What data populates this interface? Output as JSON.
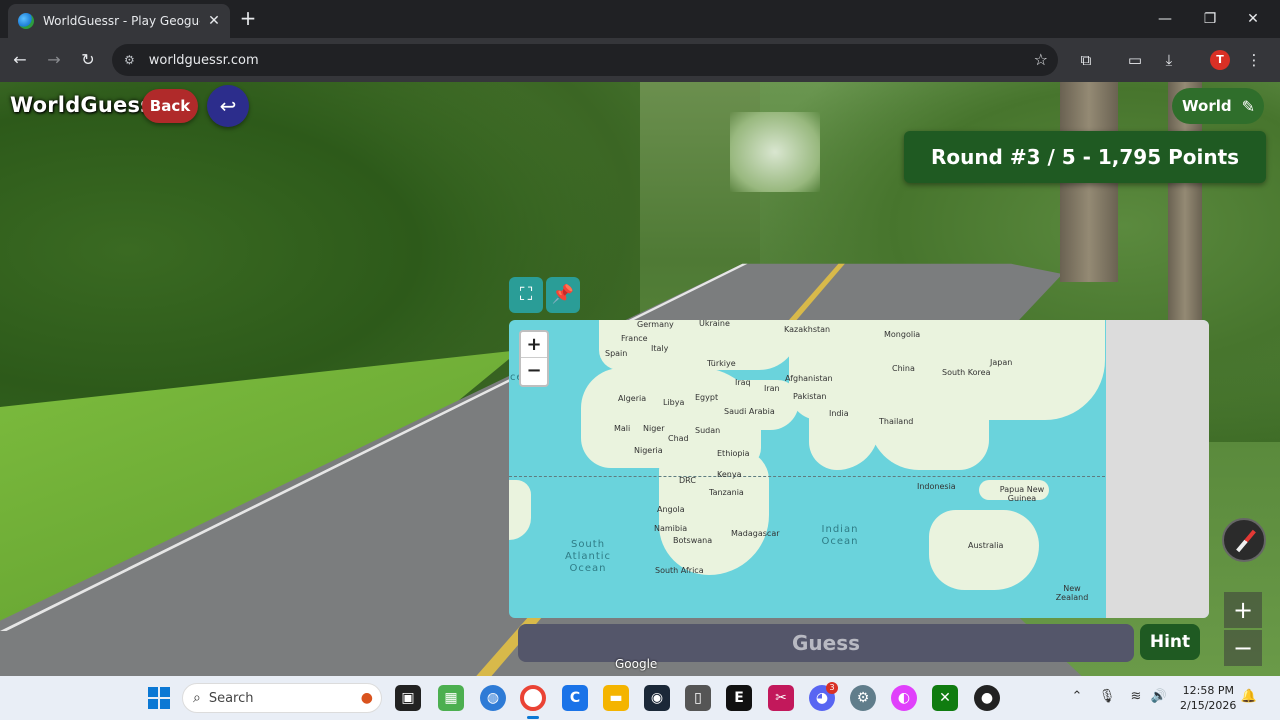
{
  "browser": {
    "tab_title": "WorldGuessr - Play Geoguessr",
    "tab_close": "✕",
    "new_tab": "+",
    "url": "worldguessr.com",
    "window_controls": {
      "minimize": "—",
      "restore": "❐",
      "close": "✕"
    },
    "profile_initial": "T"
  },
  "game": {
    "logo": "WorldGuessr",
    "back_label": "Back",
    "return_icon": "↩",
    "world_label": "World",
    "round_banner": "Round #3 / 5 - 1,795 Points",
    "guess_label": "Guess",
    "hint_label": "Hint",
    "google_attribution": "Google"
  },
  "map": {
    "zoom_in": "+",
    "zoom_out": "−",
    "country_labels": [
      "Germany",
      "Ukraine",
      "Kazakhstan",
      "Mongolia",
      "France",
      "Italy",
      "Spain",
      "Türkiye",
      "Japan",
      "Iraq",
      "Afghanistan",
      "China",
      "South Korea",
      "Iran",
      "Algeria",
      "Libya",
      "Egypt",
      "Pakistan",
      "Saudi Arabia",
      "India",
      "Mali",
      "Niger",
      "Sudan",
      "Chad",
      "Thailand",
      "Nigeria",
      "Ethiopia",
      "Kenya",
      "DRC",
      "Tanzania",
      "Indonesia",
      "Papua New Guinea",
      "Angola",
      "Namibia",
      "Botswana",
      "Madagascar",
      "South Africa",
      "Australia",
      "New Zealand"
    ],
    "ocean_labels": {
      "south_atlantic": "South Atlantic Ocean",
      "indian": "Indian Ocean",
      "partial_left": "o cean"
    }
  },
  "taskbar": {
    "search_placeholder": "Search",
    "clock_time": "12:58 PM",
    "clock_date": "2/15/2026",
    "discord_badge": "3"
  },
  "icons": {
    "fullscreen": "fullscreen-icon",
    "pin": "pin-icon",
    "pencil": "pencil-icon",
    "compass": "compass-icon"
  },
  "colors": {
    "back_button": "#b02a2a",
    "return_button": "#2c2d8c",
    "round_banner": "#1f5a22",
    "map_ocean": "#6ad3dc",
    "map_controls": "#2a9d97",
    "guess_button": "#54566a"
  }
}
